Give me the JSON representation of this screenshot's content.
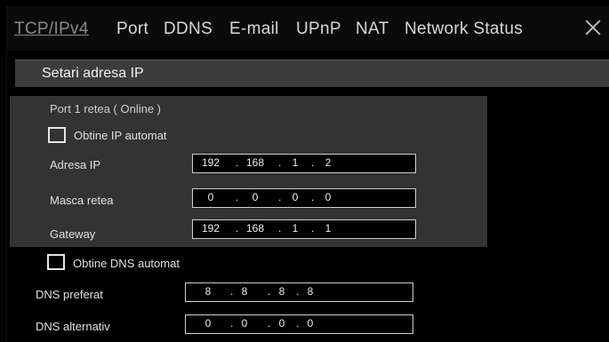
{
  "tabs": [
    {
      "label": "TCP/IPv4",
      "active": true
    },
    {
      "label": "Port"
    },
    {
      "label": "DDNS"
    },
    {
      "label": "E-mail"
    },
    {
      "label": "UPnP"
    },
    {
      "label": "NAT"
    },
    {
      "label": "Network Status"
    }
  ],
  "close_icon": "close-icon",
  "section": {
    "title": "Setari adresa IP"
  },
  "port": {
    "title": "Port 1 retea ( Online )",
    "auto_ip": {
      "label": "Obtine IP automat",
      "checked": false
    },
    "ip_address": {
      "label": "Adresa IP",
      "octets": [
        "192",
        "168",
        "1",
        "2"
      ]
    },
    "subnet_mask": {
      "label": "Masca retea",
      "octets": [
        "0",
        "0",
        "0",
        "0"
      ]
    },
    "gateway": {
      "label": "Gateway",
      "octets": [
        "192",
        "168",
        "1",
        "1"
      ]
    }
  },
  "dns": {
    "auto_dns": {
      "label": "Obtine DNS automat",
      "checked": false
    },
    "preferred": {
      "label": "DNS preferat",
      "octets": [
        "8",
        "8",
        "8",
        "8"
      ]
    },
    "alternate": {
      "label": "DNS alternativ",
      "octets": [
        "0",
        "0",
        "0",
        "0"
      ]
    }
  },
  "colors": {
    "background": "#000000",
    "panel": "#333333",
    "section_bar": "#3c3c3c",
    "active_tab": "#8a8a8a"
  }
}
